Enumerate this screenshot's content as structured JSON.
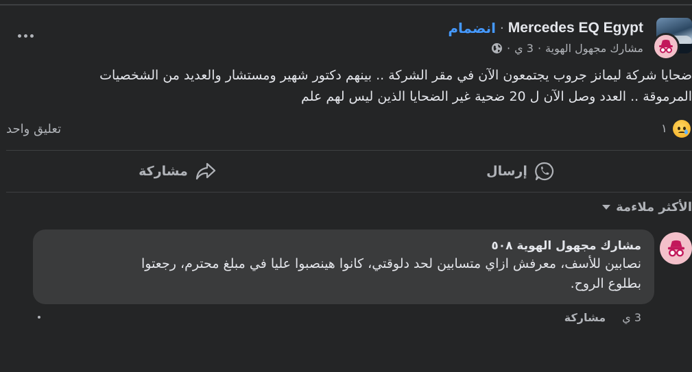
{
  "post": {
    "page_name": "Mercedes EQ Egypt",
    "separator": "·",
    "join_label": "انضمام",
    "author": "مشارك مجهول الهوية",
    "time": "3 ي",
    "meta_separator": "·",
    "text_line1": "ضحايا شركة ليمانز جروب يجتمعون الآن في مقر الشركة .. بينهم دكتور شهير ومستشار والعديد من الشخصيات",
    "text_line2": "المرموقة .. العدد وصل الآن ل 20 ضحية غير الضحايا الذين ليس لهم علم",
    "reaction_count": "١",
    "reaction_type": "sad",
    "comment_count_label": "تعليق واحد"
  },
  "actions": {
    "send_label": "إرسال",
    "share_label": "مشاركة"
  },
  "sort": {
    "label": "الأكثر ملاءمة"
  },
  "comment": {
    "author": "مشارك مجهول الهوية ٥٠٨",
    "text_line1": "نصابين للأسف، معرفش ازاي متسابين لحد دلوقتي، كانوا هينصبوا عليا في مبلغ محترم، رجعتوا",
    "text_line2": "بطلوع الروح.",
    "time": "3 ي",
    "share_label": "مشاركة"
  },
  "icons": {
    "more": "more-horizontal-icon",
    "globe": "globe-icon",
    "incognito": "anonymous-member-icon",
    "whatsapp": "whatsapp-icon",
    "share": "share-arrow-icon",
    "sort_caret": "caret-down-icon"
  },
  "colors": {
    "background": "#242526",
    "link_blue": "#4599ff",
    "bubble": "#3a3b3c",
    "secondary_text": "#b0b3b8",
    "anon_avatar": "#f3c0ca"
  }
}
